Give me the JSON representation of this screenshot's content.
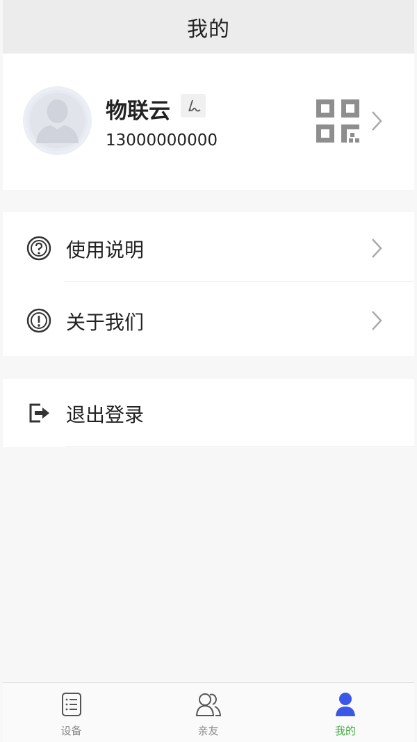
{
  "header": {
    "title": "我的"
  },
  "profile": {
    "name": "物联云",
    "phone": "13000000000",
    "icons": {
      "avatar": "default-user-avatar",
      "edit": "signature-edit-icon",
      "qr": "qr-code-icon"
    }
  },
  "menu": {
    "items": [
      {
        "label": "使用说明",
        "icon": "question-circle-icon"
      },
      {
        "label": "关于我们",
        "icon": "exclamation-circle-icon"
      }
    ],
    "logout": {
      "label": "退出登录",
      "icon": "logout-icon"
    }
  },
  "tabbar": {
    "tabs": [
      {
        "label": "设备",
        "icon": "device-list-icon",
        "active": false
      },
      {
        "label": "亲友",
        "icon": "friends-icon",
        "active": false
      },
      {
        "label": "我的",
        "icon": "user-icon",
        "active": true
      }
    ]
  },
  "colors": {
    "accent": "#3cab3c",
    "active_icon": "#3b57e8",
    "header_bg": "#ececec",
    "page_bg": "#f7f7f7"
  }
}
